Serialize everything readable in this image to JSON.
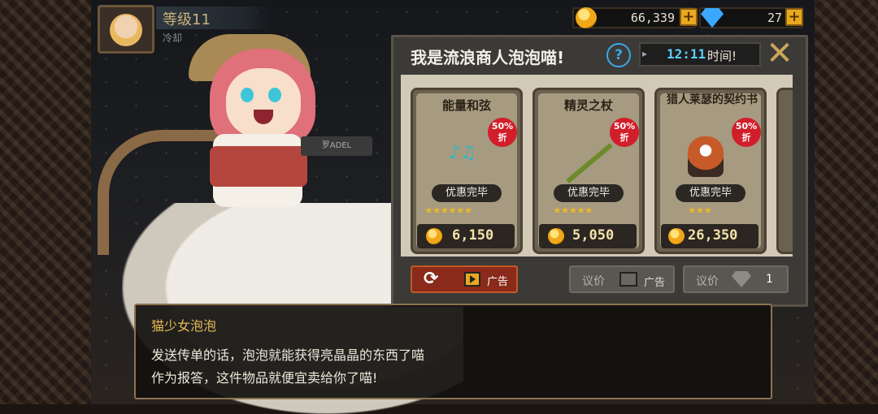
{
  "player": {
    "level_label": "等级11",
    "sub_label": "冷却",
    "character_tag": "罗ADEL"
  },
  "currency": {
    "coins": "66,339",
    "gems": "27",
    "plus": "+"
  },
  "shop": {
    "title": "我是流浪商人泡泡喵!",
    "help": "?",
    "timer_arrow": "▸",
    "timer_time": "12:11",
    "timer_label": "时间!",
    "close": "✕",
    "items": [
      {
        "name": "能量和弦",
        "discount": "50%",
        "discount_unit": "折",
        "status": "优惠完毕",
        "stars": "★★★★★★",
        "price": "6,150"
      },
      {
        "name": "精灵之杖",
        "discount": "50%",
        "discount_unit": "折",
        "status": "优惠完毕",
        "stars": "★★★★★",
        "price": "5,050"
      },
      {
        "name": "猎人莱瑟的契约书",
        "discount": "50%",
        "discount_unit": "折",
        "status": "优惠完毕",
        "stars": "★★★",
        "price": "26,350"
      }
    ],
    "refresh_button": {
      "icon": "⟳",
      "label": "广告"
    },
    "haggle_ad_button": {
      "label": "议价",
      "sub": "广告"
    },
    "haggle_gem_button": {
      "label": "议价",
      "count": "1"
    }
  },
  "dialog": {
    "speaker": "猫少女泡泡",
    "line1": "发送传单的话，泡泡就能获得亮晶晶的东西了喵",
    "line2": "作为报答，这件物品就便宜卖给你了喵!"
  },
  "colors": {
    "accent_gold": "#e8a920",
    "timer_blue": "#5ad0ff",
    "discount_red": "#d21e2a",
    "speaker_gold": "#e6b955"
  }
}
